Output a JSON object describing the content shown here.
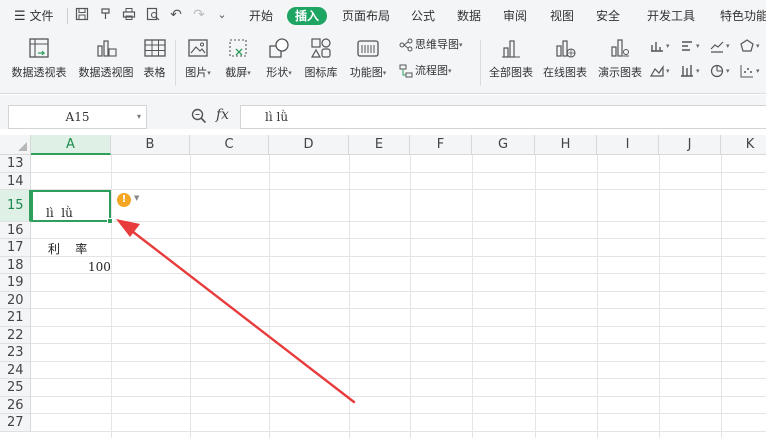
{
  "menubar": {
    "file": "文件",
    "tabs": [
      "开始",
      "插入",
      "页面布局",
      "公式",
      "数据",
      "审阅",
      "视图",
      "安全",
      "开发工具",
      "特色功能"
    ],
    "active_tab": "插入",
    "accent": "#1fa563"
  },
  "ribbon": {
    "pivot_table": "数据透视表",
    "pivot_chart": "数据透视图",
    "table": "表格",
    "picture": "图片",
    "screenshot": "截屏",
    "shapes": "形状",
    "icon_lib": "图标库",
    "function_chart": "功能图",
    "mindmap": "思维导图",
    "flowchart": "流程图",
    "all_charts": "全部图表",
    "online_chart": "在线图表",
    "demo_chart": "演示图表"
  },
  "formula_bar": {
    "name_box": "A15",
    "fx": "fx",
    "content": "lì  lǜ"
  },
  "grid": {
    "columns": [
      "A",
      "B",
      "C",
      "D",
      "E",
      "F",
      "G",
      "H",
      "I",
      "J",
      "K"
    ],
    "selected_column": "A",
    "rows": [
      "13",
      "14",
      "15",
      "16",
      "17",
      "18",
      "19",
      "20",
      "21",
      "22",
      "23",
      "24",
      "25",
      "26",
      "27"
    ],
    "selected_row": "15",
    "cells": {
      "A15": "lì  lǜ",
      "A17": "利    率",
      "A18": "100"
    },
    "selection_color": "#2e9e5b",
    "warning_color": "#f5a623",
    "annotation_color": "#e83b3b"
  }
}
